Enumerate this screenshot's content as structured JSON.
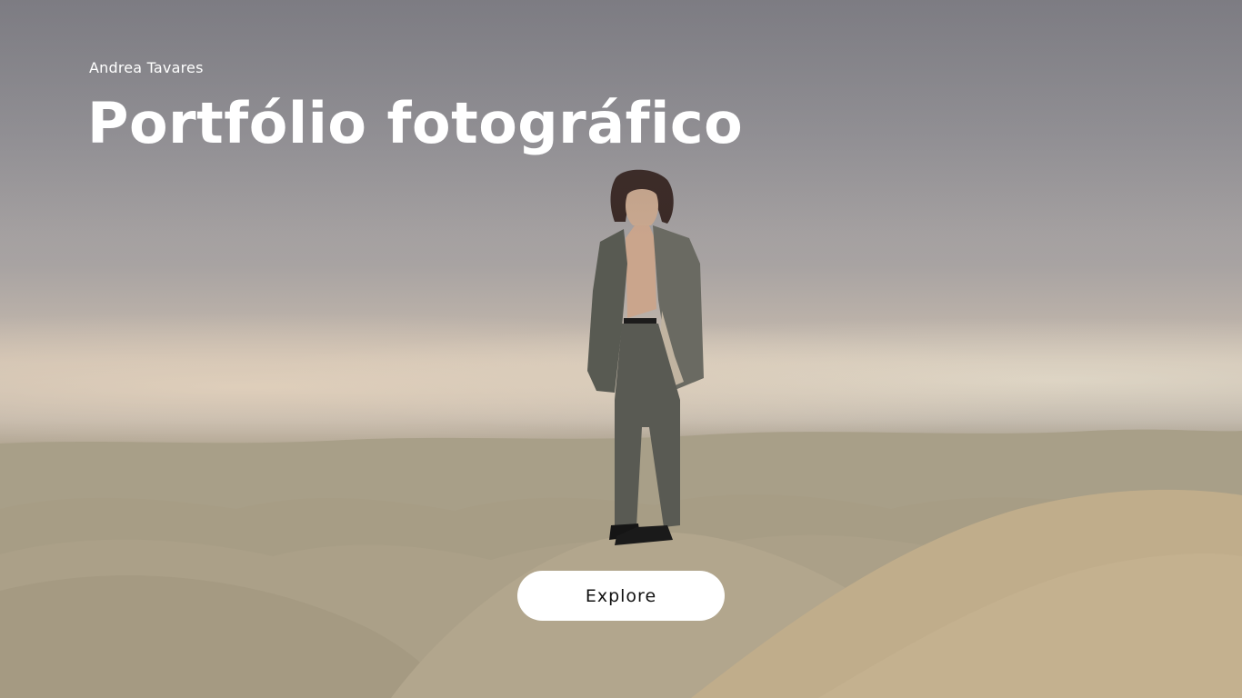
{
  "hero": {
    "author_name": "Andrea Tavares",
    "title": "Portfólio fotográfico",
    "explore_label": "Explore",
    "background_image": "person-standing-on-sand-dunes-photo"
  },
  "colors": {
    "text": "#ffffff",
    "button_bg": "#ffffff",
    "button_text": "#111111",
    "sky": "#9a989c",
    "sand": "#aca28b"
  }
}
